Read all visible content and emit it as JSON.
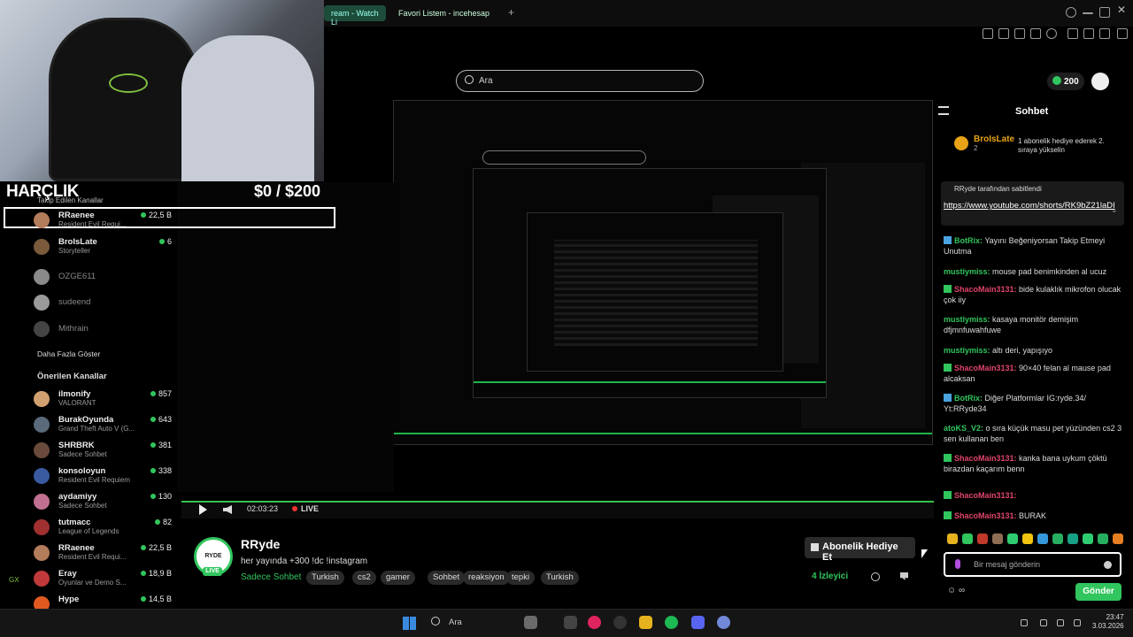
{
  "browser": {
    "tabs": [
      {
        "label": "ream - Watch Li"
      },
      {
        "label": "Favori Listem - incehesap"
      }
    ],
    "new_tab": "+"
  },
  "search": {
    "placeholder": "Ara"
  },
  "top_right": {
    "coins": "200"
  },
  "overlay": {
    "harclik": "HARÇLIK",
    "goal": "$0  / $200"
  },
  "sidebar": {
    "followed_header": "Takip Edilen Kanallar",
    "followed": [
      {
        "name": "RRaenee",
        "game": "Resident Evil Requi...",
        "viewers": "22,5 B",
        "live": true,
        "color": "#b37c5a"
      },
      {
        "name": "BroIsLate",
        "game": "Storyteller",
        "viewers": "6",
        "live": true,
        "color": "#7a5a3a"
      },
      {
        "name": "OZGE611",
        "game": "",
        "viewers": "",
        "live": false,
        "color": "#8a8a8a"
      },
      {
        "name": "sudeend",
        "game": "",
        "viewers": "",
        "live": false,
        "color": "#9a9a9a"
      },
      {
        "name": "Mithrain",
        "game": "",
        "viewers": "",
        "live": false,
        "color": "#444"
      }
    ],
    "show_more": "Daha Fazla Göster",
    "recommended_header": "Önerilen Kanallar",
    "recommended": [
      {
        "name": "ilmonify",
        "game": "VALORANT",
        "viewers": "857",
        "color": "#d2a070"
      },
      {
        "name": "BurakOyunda",
        "game": "Grand Theft Auto V (G...",
        "viewers": "643",
        "color": "#5a6a7a"
      },
      {
        "name": "SHRBRK",
        "game": "Sadece Sohbet",
        "viewers": "381",
        "color": "#6a4a3a"
      },
      {
        "name": "konsoloyun",
        "game": "Resident Evil Requiem",
        "viewers": "338",
        "color": "#3a5aa0"
      },
      {
        "name": "aydamiyy",
        "game": "Sadece Sohbet",
        "viewers": "130",
        "color": "#c07090"
      },
      {
        "name": "tutmacc",
        "game": "League of Legends",
        "viewers": "82",
        "color": "#a03030"
      },
      {
        "name": "RRaenee",
        "game": "Resident Evil Requi...",
        "viewers": "22,5 B",
        "color": "#b37c5a"
      },
      {
        "name": "Eray",
        "game": "Oyunlar ve Demo S...",
        "viewers": "18,9 B",
        "color": "#c03a3a"
      },
      {
        "name": "Hype",
        "game": "",
        "viewers": "14,5 B",
        "color": "#e05a20"
      }
    ],
    "gx_label": "GX"
  },
  "player": {
    "time": "02:03:23",
    "live": "LIVE"
  },
  "stream": {
    "avatar_text": "RYDE",
    "live_badge": "LIVE",
    "name": "RRyde",
    "title": "her yayında +300 !dc !instagram",
    "category": "Sadece Sohbet",
    "tags": [
      "Turkish",
      "cs2",
      "gamer",
      "Sohbet",
      "reaksiyon",
      "tepki",
      "Turkish"
    ],
    "subscribe": "Abonelik Hediye Et",
    "viewers": "4 İzleyici"
  },
  "chat": {
    "title": "Sohbet",
    "gift": {
      "name": "BroIsLate",
      "count": "2",
      "text": "1 abonelik hediye ederek 2. sıraya yükselin"
    },
    "pinned": {
      "header": "RRyde tarafından sabitlendi",
      "link": "https://www.youtube.com/shorts/RK9bZ21laDI"
    },
    "messages": [
      {
        "kind": "bot",
        "user": "BotRix:",
        "text": " Yayını Beğeniyorsan Takip Etmeyi Unutma",
        "color": "#31c55d"
      },
      {
        "kind": "plain",
        "user": "mustiymiss:",
        "text": " mouse pad benimkinden al ucuz",
        "color": "#31c55d"
      },
      {
        "kind": "sub",
        "user": "ShacoMain3131:",
        "text": " bide kulaklık mikrofon olucak çok iiy",
        "color": "#e0446a"
      },
      {
        "kind": "plain",
        "user": "mustiymiss:",
        "text": " kasaya monitör demişim dfjmnfuwahfuwe",
        "color": "#31c55d"
      },
      {
        "kind": "plain",
        "user": "mustiymiss:",
        "text": " altı deri, yapışıyo",
        "color": "#31c55d"
      },
      {
        "kind": "sub",
        "user": "ShacoMain3131:",
        "text": " 90×40 felan al mause pad alcaksan",
        "color": "#e0446a"
      },
      {
        "kind": "bot",
        "user": "BotRix:",
        "text": " Diğer Platformlar IG:ryde.34/ Yt:RRyde34",
        "color": "#31c55d"
      },
      {
        "kind": "plain",
        "user": "atoKS_V2:",
        "text": " o sıra küçük masu pet yüzünden cs2 3 sen kullanan ben",
        "color": "#31c55d"
      },
      {
        "kind": "sub",
        "user": "ShacoMain3131:",
        "text": " kanka bana uykum çöktü birazdan kaçarım benn",
        "color": "#e0446a"
      },
      {
        "kind": "sub",
        "user": "ShacoMain3131:",
        "text": "",
        "color": "#e0446a"
      },
      {
        "kind": "sub",
        "user": "ShacoMain3131:",
        "text": " BURAK",
        "color": "#e0446a"
      }
    ],
    "input_placeholder": "Bir mesaj gönderin",
    "send": "Gönder"
  },
  "taskbar": {
    "search": "Ara",
    "time": "23:47",
    "date": "3.03.2026"
  }
}
